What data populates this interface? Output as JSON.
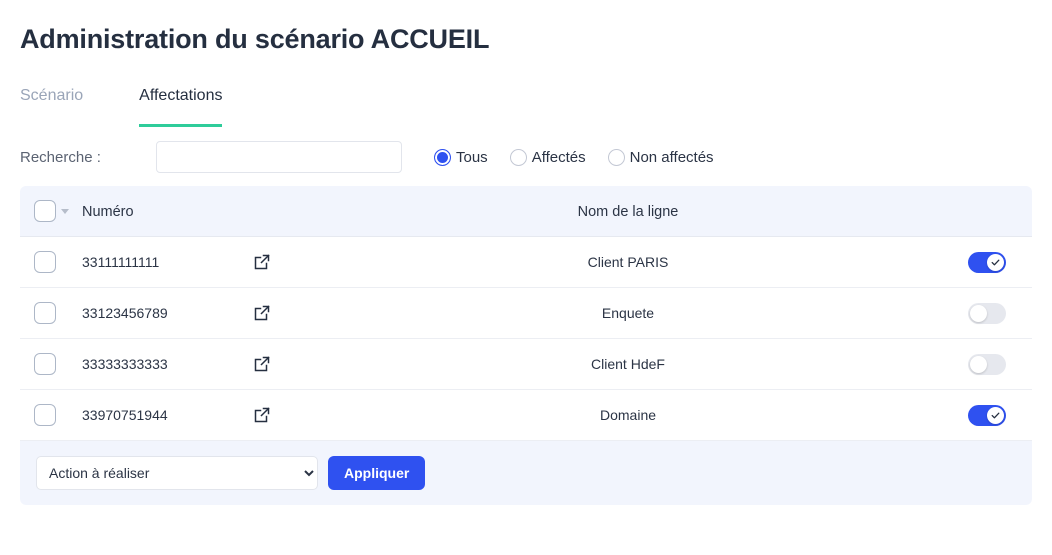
{
  "page_title": "Administration du scénario ACCUEIL",
  "colors": {
    "accent_green": "#2ecc9a",
    "accent_blue": "#2f51f0",
    "header_bg": "#f2f5fd"
  },
  "tabs": [
    {
      "label": "Scénario",
      "active": false
    },
    {
      "label": "Affectations",
      "active": true
    }
  ],
  "filter": {
    "search_label": "Recherche :",
    "search_value": "",
    "search_placeholder": "",
    "radios": [
      {
        "label": "Tous",
        "selected": true
      },
      {
        "label": "Affectés",
        "selected": false
      },
      {
        "label": "Non affectés",
        "selected": false
      }
    ]
  },
  "table": {
    "columns": {
      "numero": "Numéro",
      "nom_de_la_ligne": "Nom de la ligne"
    },
    "select_all_checked": false,
    "rows": [
      {
        "checked": false,
        "numero": "33111111111",
        "nom": "Client PARIS",
        "toggle": true
      },
      {
        "checked": false,
        "numero": "33123456789",
        "nom": "Enquete",
        "toggle": false
      },
      {
        "checked": false,
        "numero": "33333333333",
        "nom": "Client HdeF",
        "toggle": false
      },
      {
        "checked": false,
        "numero": "33970751944",
        "nom": "Domaine",
        "toggle": true
      }
    ]
  },
  "footer": {
    "action_select_value": "Action à réaliser",
    "action_options": [
      "Action à réaliser"
    ],
    "apply_label": "Appliquer"
  }
}
